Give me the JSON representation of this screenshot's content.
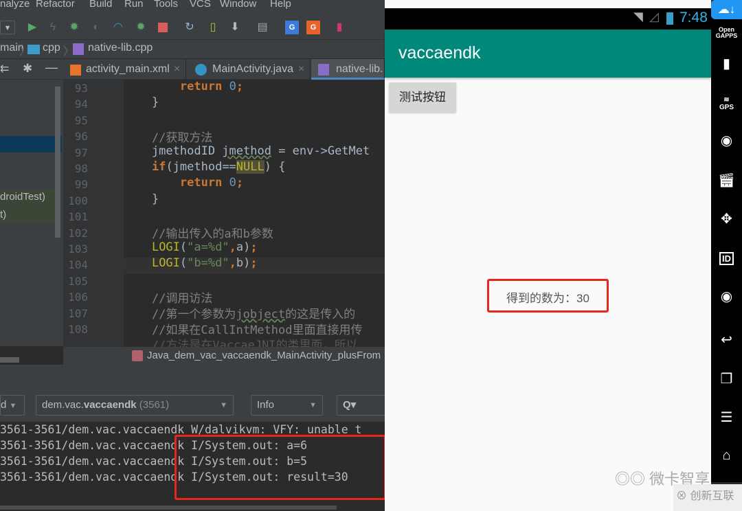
{
  "ide": {
    "menu": [
      "nalyze",
      "Refactor",
      "Build",
      "Run",
      "Tools",
      "VCS",
      "Window",
      "Help"
    ],
    "toolbar_icons": [
      "dropdown-icon",
      "run-icon",
      "apply-changes-icon",
      "debug-icon",
      "coverage-icon",
      "profile-icon",
      "attach-debugger-icon",
      "stop-icon",
      "gradle-sync-icon",
      "avd-manager-icon",
      "sdk-manager-icon",
      "project-structure-icon",
      "translate-icon",
      "translate-2-icon",
      "device-icon"
    ],
    "breadcrumb": [
      "main",
      "cpp",
      "native-lib.cpp"
    ],
    "tabs": [
      {
        "label": "activity_main.xml",
        "icon": "xml-file-icon"
      },
      {
        "label": "MainActivity.java",
        "icon": "java-class-icon"
      },
      {
        "label": "native-lib.",
        "icon": "cpp-file-icon",
        "active": true
      }
    ],
    "project_tree": [
      "droidTest)",
      "t)"
    ],
    "line_numbers": [
      "93",
      "94",
      "95",
      "96",
      "97",
      "98",
      "99",
      "100",
      "101",
      "102",
      "103",
      "104",
      "105",
      "106",
      "107",
      "108"
    ],
    "function_breadcrumb": "Java_dem_vac_vaccaendk_MainActivity_plusFrom",
    "logcat": {
      "device_filter": "d",
      "process_filter": {
        "prefix": "dem.vac.",
        "bold": "vaccaendk",
        "pid": "(3561)"
      },
      "level": "Info",
      "search_placeholder": "Q▾",
      "lines": [
        "3561-3561/dem.vac.vaccaendk W/dalvikvm: VFY: unable t",
        "3561-3561/dem.vac.vaccaendk I/System.out: a=6",
        "3561-3561/dem.vac.vaccaendk I/System.out: b=5",
        "3561-3561/dem.vac.vaccaendk I/System.out: result=30"
      ]
    }
  },
  "emulator": {
    "time": "7:48",
    "app_title": "vaccaendk",
    "button_label": "测试按钮",
    "result_text": "得到的数为：30",
    "side_toolbar": {
      "open_gapps": "Open",
      "gapps": "GAPPS",
      "gps": "GPS",
      "id": "ID"
    },
    "accent": "#00897b"
  },
  "watermark": {
    "wechat": "微卡智享",
    "logo": "创新互联"
  },
  "highlight_color": "#e8261c"
}
